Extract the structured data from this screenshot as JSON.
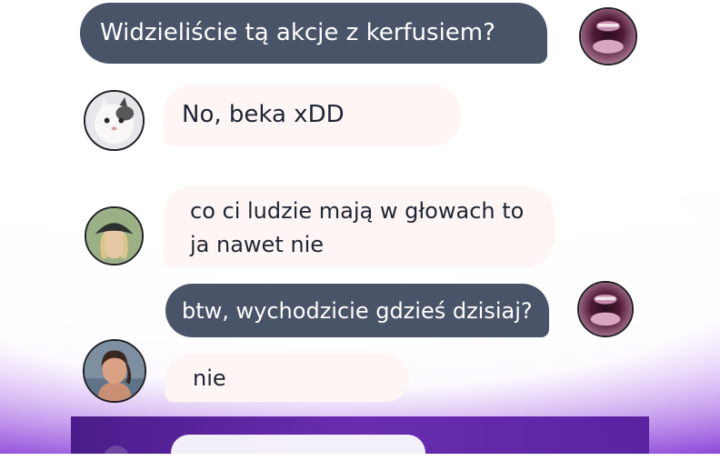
{
  "messages": [
    {
      "id": 1,
      "direction": "outgoing",
      "text": "Widzieliście tą akcje z kerfusiem?",
      "avatar": "avatar-mouth-photo"
    },
    {
      "id": 2,
      "direction": "incoming",
      "text": "No, beka xDD",
      "avatar": "avatar-cat-photo"
    },
    {
      "id": 3,
      "direction": "incoming",
      "lines": [
        "co ci ludzie mają w głowach to",
        "ja nawet nie"
      ],
      "avatar": "avatar-hat-person-photo"
    },
    {
      "id": 4,
      "direction": "outgoing",
      "text": "btw, wychodzicie gdzieś dzisiaj?",
      "avatar": "avatar-mouth-photo"
    },
    {
      "id": 5,
      "direction": "incoming",
      "text": "nie",
      "avatar": "avatar-woman-photo"
    }
  ],
  "colors": {
    "outgoing_bubble": "#4a5468",
    "incoming_bubble": "#fdf6f4",
    "outgoing_text": "#ffffff",
    "incoming_text": "#1f2433",
    "background_accent": "#9b57e0"
  }
}
